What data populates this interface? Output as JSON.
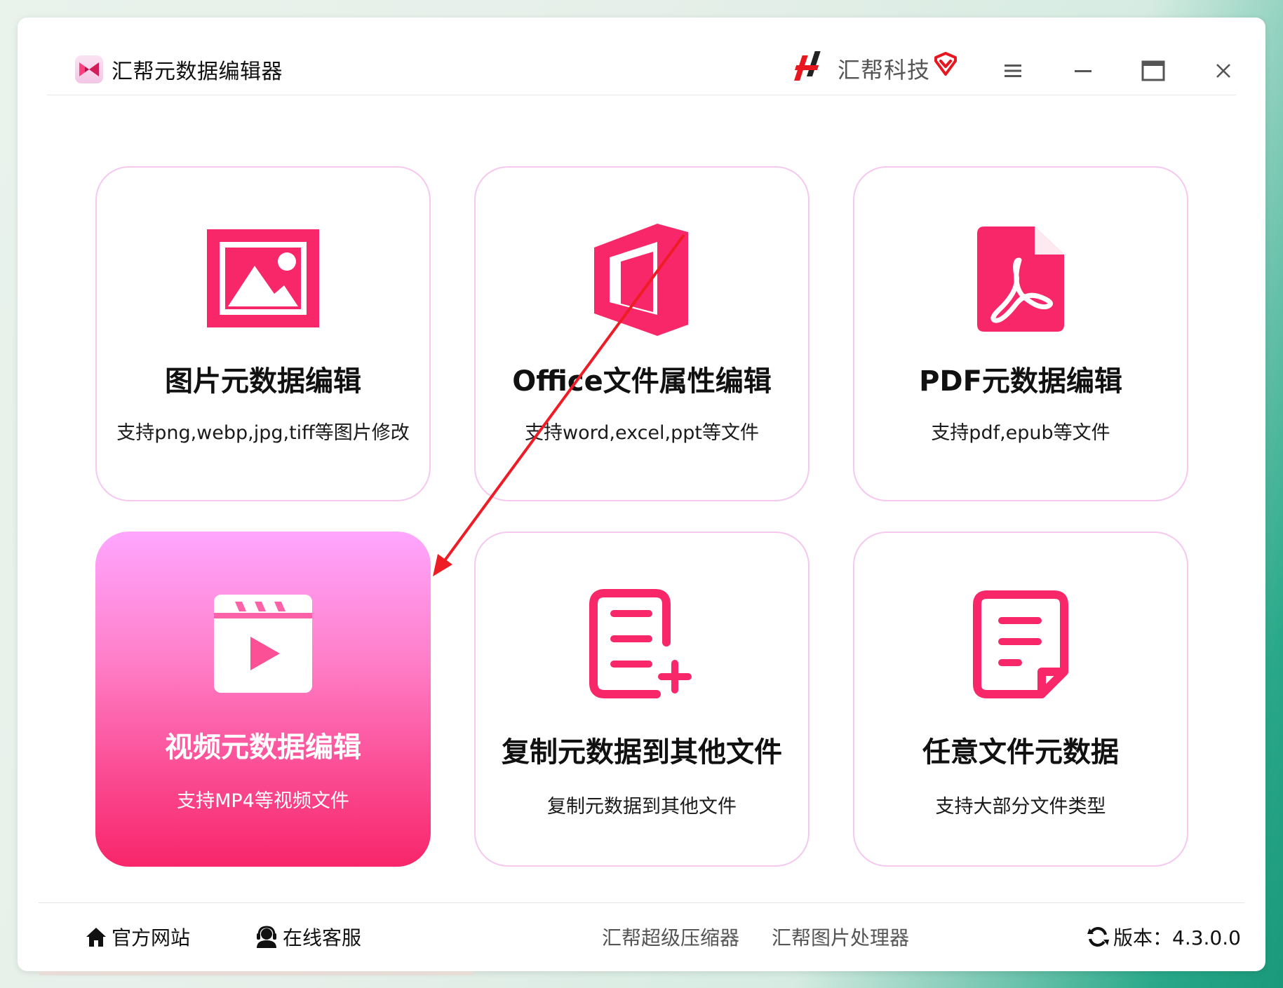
{
  "app": {
    "title": "汇帮元数据编辑器",
    "brand_name": "汇帮科技"
  },
  "colors": {
    "accent": "#f8276a",
    "active_card_top": "#ffa6ff",
    "active_card_bottom": "#f8256a",
    "card_border": "#f6c8f0",
    "annotation_arrow": "#ee1c24"
  },
  "window_controls": {
    "icons": [
      "menu-icon",
      "minimize-icon",
      "maximize-icon",
      "close-icon"
    ]
  },
  "cards": [
    {
      "title": "图片元数据编辑",
      "subtitle": "支持png,webp,jpg,tiff等图片修改",
      "icon": "image-icon",
      "active": false
    },
    {
      "title": "Office文件属性编辑",
      "subtitle": "支持word,excel,ppt等文件",
      "icon": "office-icon",
      "active": false
    },
    {
      "title": "PDF元数据编辑",
      "subtitle": "支持pdf,epub等文件",
      "icon": "pdf-icon",
      "active": false
    },
    {
      "title": "视频元数据编辑",
      "subtitle": "支持MP4等视频文件",
      "icon": "video-clapper-icon",
      "active": true
    },
    {
      "title": "复制元数据到其他文件",
      "subtitle": "复制元数据到其他文件",
      "icon": "document-add-icon",
      "active": false
    },
    {
      "title": "任意文件元数据",
      "subtitle": "支持大部分文件类型",
      "icon": "document-icon",
      "active": false
    }
  ],
  "footer": {
    "website": "官方网站",
    "support": "在线客服",
    "compressor": "汇帮超级压缩器",
    "image_processor": "汇帮图片处理器",
    "version": "版本：4.3.0.0"
  }
}
